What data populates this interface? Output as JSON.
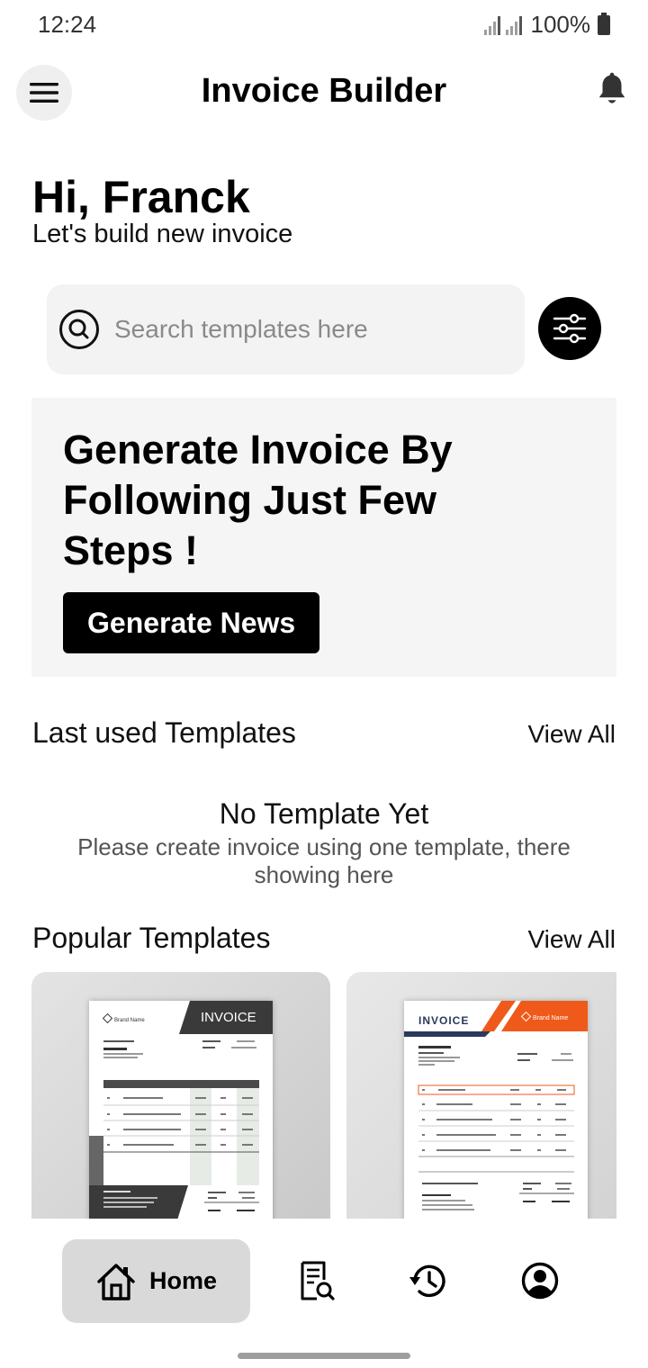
{
  "status_bar": {
    "time": "12:24",
    "battery": "100%"
  },
  "header": {
    "title": "Invoice Builder",
    "menu_icon": "hamburger-menu-icon",
    "notification_icon": "bell-icon"
  },
  "greeting": {
    "title": "Hi, Franck",
    "subtitle": "Let's build new invoice"
  },
  "search": {
    "placeholder": "Search templates here",
    "value": "",
    "filter_icon": "sliders-icon"
  },
  "banner": {
    "title": "Generate Invoice By Following Just Few Steps !",
    "button_label": "Generate News"
  },
  "last_used": {
    "title": "Last used Templates",
    "view_all": "View All",
    "empty_title": "No Template Yet",
    "empty_description": "Please create invoice using one template, there showing here"
  },
  "popular": {
    "title": "Popular Templates",
    "view_all": "View All",
    "templates": [
      {
        "heading": "INVOICE",
        "brand": "Brand Name",
        "accent": "#3a3a3a"
      },
      {
        "heading": "INVOICE",
        "brand": "Brand Name",
        "accent": "#ef5a1a"
      }
    ]
  },
  "bottom_nav": {
    "items": [
      {
        "label": "Home",
        "icon": "home-icon",
        "active": true
      },
      {
        "label": "",
        "icon": "invoice-search-icon",
        "active": false
      },
      {
        "label": "",
        "icon": "history-icon",
        "active": false
      },
      {
        "label": "",
        "icon": "profile-icon",
        "active": false
      }
    ]
  },
  "colors": {
    "primary": "#000000",
    "surface": "#f5f5f5",
    "active_nav": "#d9d9d9",
    "accent_orange": "#ef5a1a",
    "accent_navy": "#2b3a5c"
  }
}
